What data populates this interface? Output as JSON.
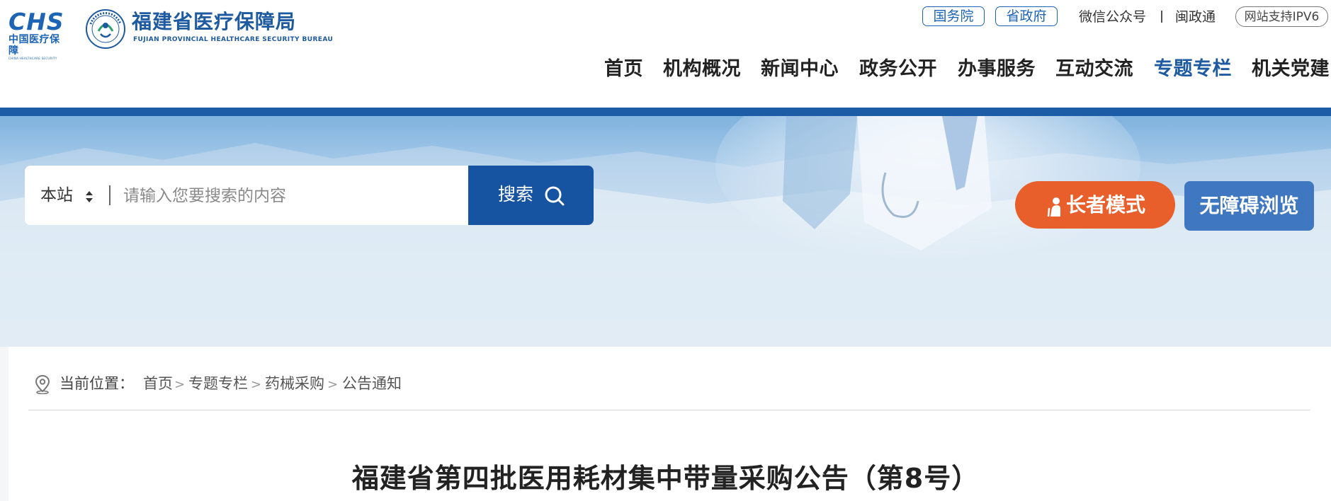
{
  "logo": {
    "chs_mark": "CHS",
    "chs_cn": "中国医疗保障",
    "chs_en": "CHINA HEALTHCARE SECURITY",
    "bureau_name": "福建省医疗保障局",
    "bureau_en": "FUJIAN PROVINCIAL HEALTHCARE SECURITY BUREAU"
  },
  "top_links": {
    "state_council": "国务院",
    "provincial_gov": "省政府",
    "wechat": "微信公众号",
    "minzhengtong": "闽政通",
    "ipv6": "网站支持IPV6"
  },
  "nav": {
    "items": [
      "首页",
      "机构概况",
      "新闻中心",
      "政务公开",
      "办事服务",
      "互动交流",
      "专题专栏",
      "机关党建"
    ],
    "active_index": 6
  },
  "search": {
    "scope": "本站",
    "placeholder": "请输入您要搜索的内容",
    "value": "",
    "button_label": "搜索"
  },
  "accessibility": {
    "elder_mode": "长者模式",
    "barrier_free": "无障碍浏览"
  },
  "breadcrumb": {
    "label": "当前位置：",
    "items": [
      "首页",
      "专题专栏",
      "药械采购",
      "公告通知"
    ],
    "separator": ">"
  },
  "article": {
    "title": "福建省第四批医用耗材集中带量采购公告（第8号）"
  },
  "colors": {
    "brand_blue": "#1e5aa0",
    "header_bar": "#1c5ba6",
    "search_button": "#1653a0",
    "elder_button": "#e85f2c",
    "access_button": "#3f78c0"
  }
}
